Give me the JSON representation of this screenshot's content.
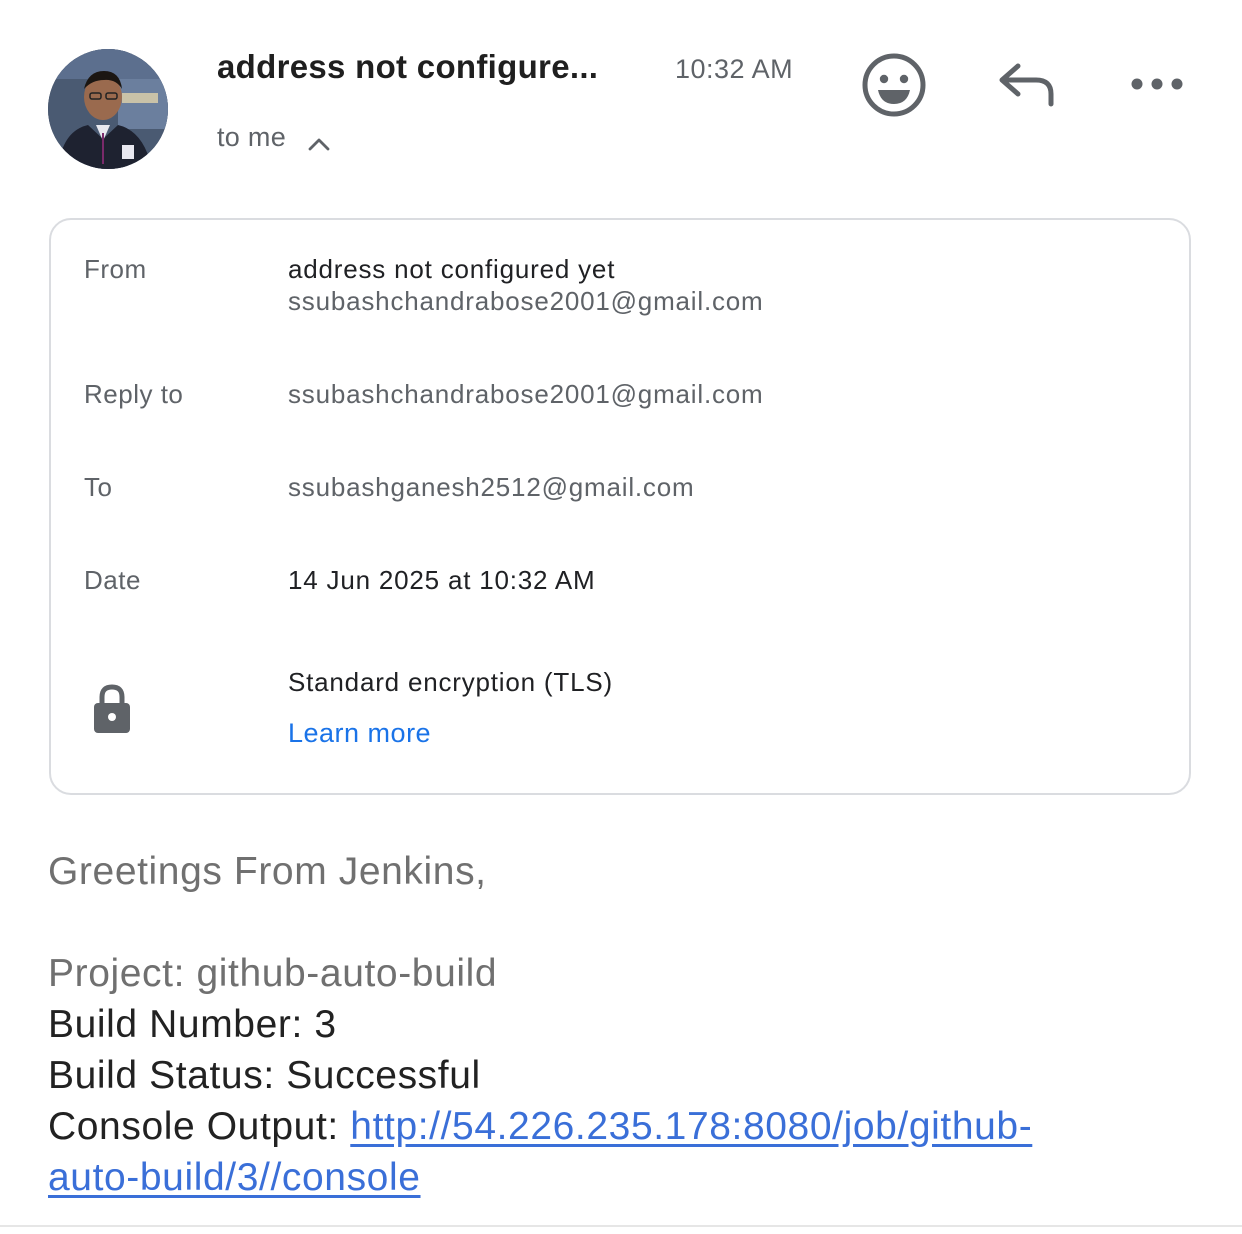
{
  "header": {
    "sender_name": "address not configure...",
    "time": "10:32 AM",
    "recipient_summary": "to me"
  },
  "details": {
    "from_label": "From",
    "from_name": "address not configured yet",
    "from_email": "ssubashchandrabose2001@gmail.com",
    "reply_to_label": "Reply to",
    "reply_to_email": "ssubashchandrabose2001@gmail.com",
    "to_label": "To",
    "to_email": "ssubashganesh2512@gmail.com",
    "date_label": "Date",
    "date_value": "14 Jun 2025 at 10:32 AM",
    "encryption": "Standard encryption (TLS)",
    "learn_more": "Learn more"
  },
  "message": {
    "greeting": "Greetings From Jenkins,",
    "project": "Project: github-auto-build",
    "build_number": "Build Number: 3",
    "build_status": "Build Status: Successful",
    "console_label": "Console Output: ",
    "console_link_line1": "http://54.226.235.178:8080/job/github-",
    "console_link_line2": "auto-build/3//console"
  },
  "colors": {
    "link": "#1a73e8",
    "body_link": "#3a6fd8",
    "secondary_text": "#5f6368",
    "card_border": "#dadce0"
  },
  "icons": [
    "avatar",
    "chevron-up-icon",
    "emoji-reaction-icon",
    "reply-icon",
    "more-options-icon",
    "lock-icon"
  ]
}
